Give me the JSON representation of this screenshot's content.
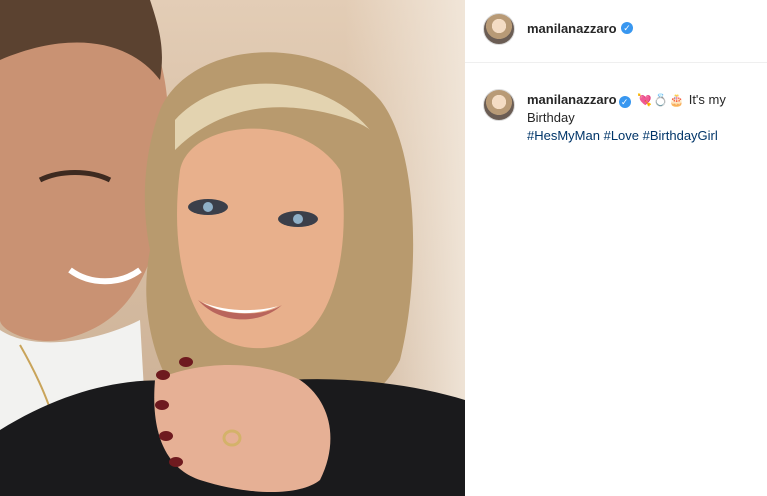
{
  "post": {
    "username": "manilanazzaro",
    "verified_icon": "verified-badge-icon",
    "caption": {
      "username": "manilanazzaro",
      "emojis": [
        "💘",
        "💍",
        "🎂"
      ],
      "text": "It's my Birthday",
      "hashtags": [
        "#HesMyMan",
        "#Love",
        "#BirthdayGirl"
      ]
    }
  },
  "colors": {
    "verified": "#3897f0",
    "hashtag": "#003569",
    "text": "#262626",
    "divider": "#efefef"
  }
}
